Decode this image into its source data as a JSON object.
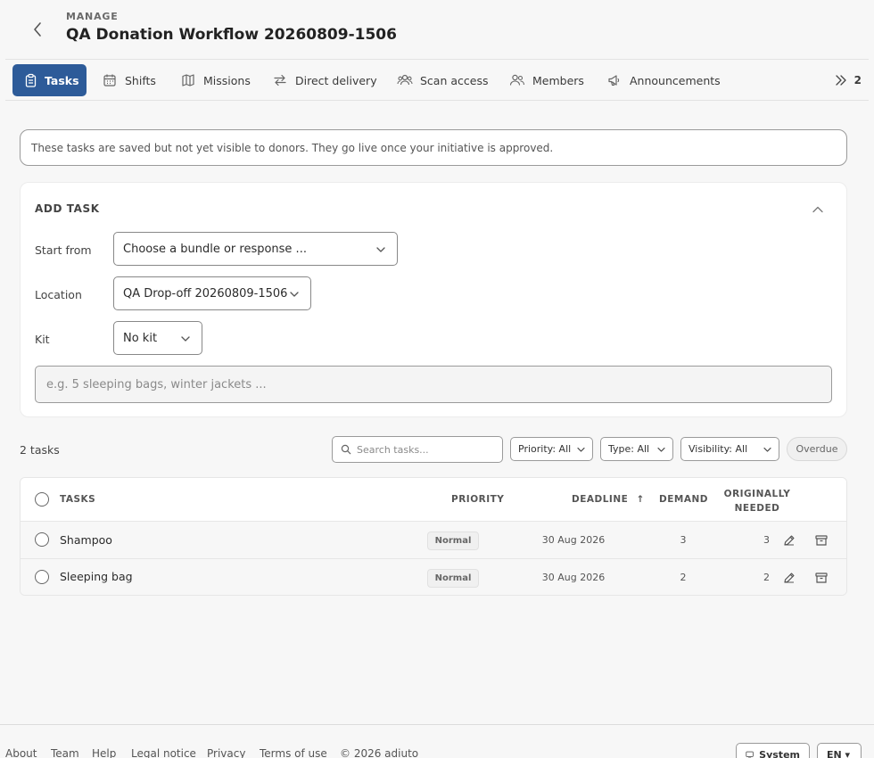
{
  "header": {
    "kicker": "MANAGE",
    "title": "QA Donation Workflow 20260809-1506"
  },
  "tabs": [
    {
      "label": "Tasks",
      "icon": "clipboard-icon",
      "active": true
    },
    {
      "label": "Shifts",
      "icon": "calendar-icon"
    },
    {
      "label": "Missions",
      "icon": "map-icon"
    },
    {
      "label": "Direct delivery",
      "icon": "arrows-exchange-icon"
    },
    {
      "label": "Scan access",
      "icon": "users-group-icon"
    },
    {
      "label": "Members",
      "icon": "members-icon"
    },
    {
      "label": "Announcements",
      "icon": "megaphone-icon"
    }
  ],
  "tabs_more": {
    "count": "2",
    "icon": "chevrons-right-icon"
  },
  "notice": "These tasks are saved but not yet visible to donors. They go live once your initiative is approved.",
  "add_task": {
    "title": "ADD TASK",
    "start_from": {
      "label": "Start from",
      "value": "Choose a bundle or response ..."
    },
    "location": {
      "label": "Location",
      "value": "QA Drop-off 20260809-1506"
    },
    "kit": {
      "label": "Kit",
      "value": "No kit"
    },
    "input_placeholder": "e.g. 5 sleeping bags, winter jackets ..."
  },
  "toolbar": {
    "count": "2 tasks",
    "search_placeholder": "Search tasks...",
    "filters": {
      "priority": "Priority: All",
      "type": "Type: All",
      "visibility": "Visibility: All"
    },
    "overdue": "Overdue"
  },
  "table": {
    "headers": {
      "tasks": "TASKS",
      "priority": "PRIORITY",
      "deadline": "DEADLINE",
      "sort_arrow": "↑",
      "demand": "DEMAND",
      "originally_1": "ORIGINALLY",
      "originally_2": "NEEDED"
    },
    "rows": [
      {
        "name": "Shampoo",
        "priority": "Normal",
        "deadline": "30 Aug 2026",
        "demand": "3",
        "originally_needed": "3"
      },
      {
        "name": "Sleeping bag",
        "priority": "Normal",
        "deadline": "30 Aug 2026",
        "demand": "2",
        "originally_needed": "2"
      }
    ]
  },
  "footer": {
    "links": [
      "About",
      "Team",
      "Help",
      "Legal notice",
      "Privacy",
      "Terms of use"
    ],
    "copyright": "© 2026 adiuto",
    "theme": "System",
    "language": "EN ▾"
  },
  "colors": {
    "accent": "#2d5b99",
    "background": "#f7f7f7"
  }
}
